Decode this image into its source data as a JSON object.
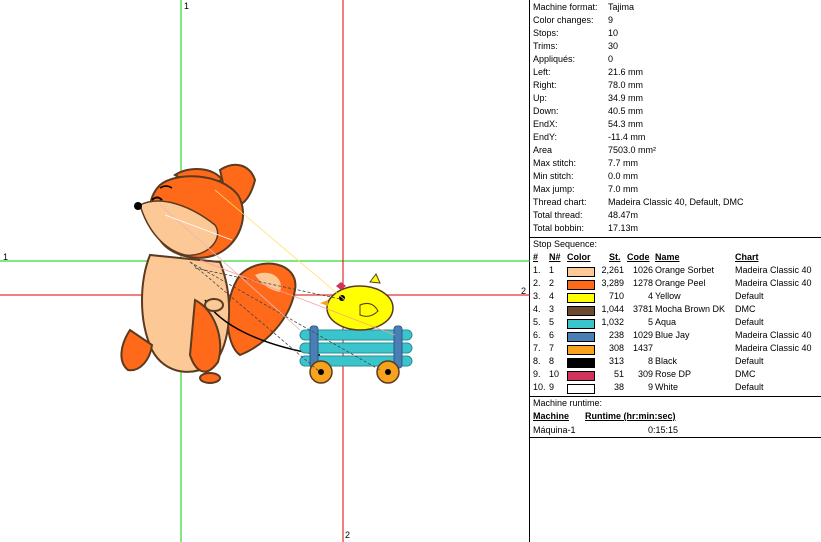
{
  "axes": {
    "label_top": "1",
    "label_left": "1",
    "label_right": "2",
    "label_bottom": "2"
  },
  "properties": [
    {
      "key": "Machine format:",
      "value": "Tajima"
    },
    {
      "key": "Color changes:",
      "value": "9"
    },
    {
      "key": "Stops:",
      "value": "10"
    },
    {
      "key": "Trims:",
      "value": "30"
    },
    {
      "key": "Appliqués:",
      "value": "0"
    },
    {
      "key": "Left:",
      "value": "21.6 mm"
    },
    {
      "key": "Right:",
      "value": "78.0 mm"
    },
    {
      "key": "Up:",
      "value": "34.9 mm"
    },
    {
      "key": "Down:",
      "value": "40.5 mm"
    },
    {
      "key": "EndX:",
      "value": "54.3 mm"
    },
    {
      "key": "EndY:",
      "value": "-11.4 mm"
    },
    {
      "key": "Area",
      "value": "7503.0 mm²"
    },
    {
      "key": "Max stitch:",
      "value": "7.7 mm"
    },
    {
      "key": "Min stitch:",
      "value": "0.0 mm"
    },
    {
      "key": "Max jump:",
      "value": "7.0 mm"
    },
    {
      "key": "Thread chart:",
      "value": "Madeira Classic 40, Default, DMC"
    },
    {
      "key": "Total thread:",
      "value": "48.47m"
    },
    {
      "key": "Total bobbin:",
      "value": "17.13m"
    }
  ],
  "stop_sequence": {
    "title": "Stop Sequence:",
    "headers": {
      "num": "#",
      "n": "N#",
      "color": "Color",
      "st": "St.",
      "code": "Code",
      "name": "Name",
      "chart": "Chart"
    },
    "rows": [
      {
        "num": "1.",
        "n": "1",
        "color": "#fcc896",
        "st": "2,261",
        "code": "1026",
        "name": "Orange Sorbet",
        "chart": "Madeira Classic 40"
      },
      {
        "num": "2.",
        "n": "2",
        "color": "#ff6a1a",
        "st": "3,289",
        "code": "1278",
        "name": "Orange Peel",
        "chart": "Madeira Classic 40"
      },
      {
        "num": "3.",
        "n": "4",
        "color": "#ffff00",
        "st": "710",
        "code": "4",
        "name": "Yellow",
        "chart": "Default"
      },
      {
        "num": "4.",
        "n": "3",
        "color": "#6b4a2e",
        "st": "1,044",
        "code": "3781",
        "name": "Mocha Brown DK",
        "chart": "DMC"
      },
      {
        "num": "5.",
        "n": "5",
        "color": "#3ac4cc",
        "st": "1,032",
        "code": "5",
        "name": "Aqua",
        "chart": "Default"
      },
      {
        "num": "6.",
        "n": "6",
        "color": "#4a7fb5",
        "st": "238",
        "code": "1029",
        "name": "Blue Jay",
        "chart": "Madeira Classic 40"
      },
      {
        "num": "7.",
        "n": "7",
        "color": "#f7a21c",
        "st": "308",
        "code": "1437",
        "name": "",
        "chart": "Madeira Classic 40"
      },
      {
        "num": "8.",
        "n": "8",
        "color": "#000000",
        "st": "313",
        "code": "8",
        "name": "Black",
        "chart": "Default"
      },
      {
        "num": "9.",
        "n": "10",
        "color": "#d0335c",
        "st": "51",
        "code": "309",
        "name": "Rose DP",
        "chart": "DMC"
      },
      {
        "num": "10.",
        "n": "9",
        "color": "#ffffff",
        "st": "38",
        "code": "9",
        "name": "White",
        "chart": "Default"
      }
    ]
  },
  "runtime": {
    "title": "Machine runtime:",
    "headers": {
      "machine": "Machine",
      "runtime": "Runtime (hr:min:sec)"
    },
    "rows": [
      {
        "machine": "Máquina-1",
        "runtime": "0:15:15"
      }
    ]
  }
}
